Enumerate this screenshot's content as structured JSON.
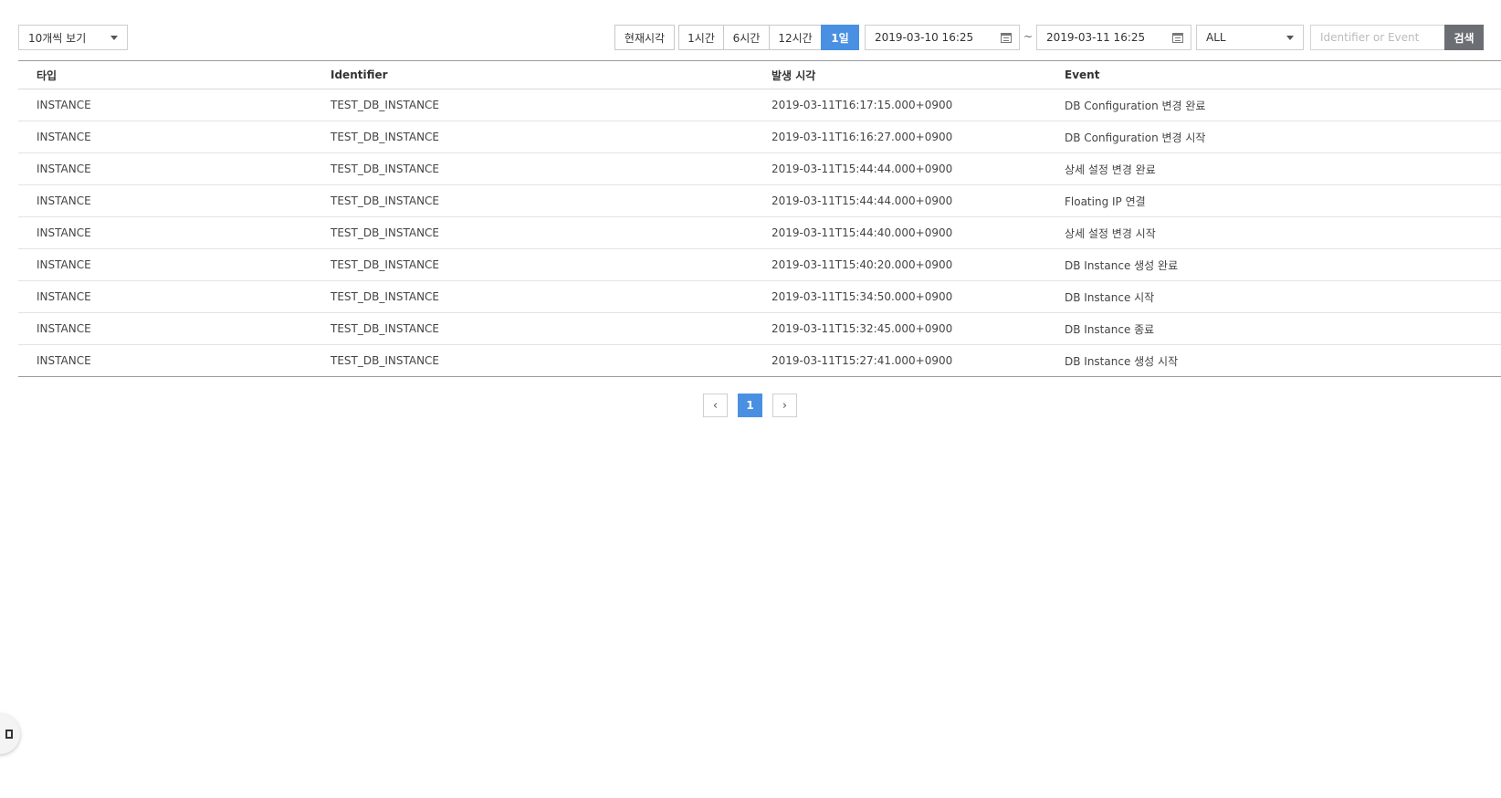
{
  "toolbar": {
    "page_size": "10개씩 보기",
    "time_buttons": [
      "현재시각",
      "1시간",
      "6시간",
      "12시간",
      "1일"
    ],
    "active_time": "1일",
    "date_from": "2019-03-10 16:25",
    "date_separator": "~",
    "date_to": "2019-03-11 16:25",
    "type_filter": "ALL",
    "search_placeholder": "Identifier or Event",
    "search_label": "검색"
  },
  "table": {
    "headers": [
      "타입",
      "Identifier",
      "발생 시각",
      "Event"
    ],
    "rows": [
      [
        "INSTANCE",
        "TEST_DB_INSTANCE",
        "2019-03-11T16:17:15.000+0900",
        "DB Configuration 변경 완료"
      ],
      [
        "INSTANCE",
        "TEST_DB_INSTANCE",
        "2019-03-11T16:16:27.000+0900",
        "DB Configuration 변경 시작"
      ],
      [
        "INSTANCE",
        "TEST_DB_INSTANCE",
        "2019-03-11T15:44:44.000+0900",
        "상세 설정 변경 완료"
      ],
      [
        "INSTANCE",
        "TEST_DB_INSTANCE",
        "2019-03-11T15:44:44.000+0900",
        "Floating IP 연결"
      ],
      [
        "INSTANCE",
        "TEST_DB_INSTANCE",
        "2019-03-11T15:44:40.000+0900",
        "상세 설정 변경 시작"
      ],
      [
        "INSTANCE",
        "TEST_DB_INSTANCE",
        "2019-03-11T15:40:20.000+0900",
        "DB Instance 생성 완료"
      ],
      [
        "INSTANCE",
        "TEST_DB_INSTANCE",
        "2019-03-11T15:34:50.000+0900",
        "DB Instance 시작"
      ],
      [
        "INSTANCE",
        "TEST_DB_INSTANCE",
        "2019-03-11T15:32:45.000+0900",
        "DB Instance 종료"
      ],
      [
        "INSTANCE",
        "TEST_DB_INSTANCE",
        "2019-03-11T15:27:41.000+0900",
        "DB Instance 생성 시작"
      ]
    ]
  },
  "pagination": {
    "prev": "‹",
    "current_page": "1",
    "next": "›"
  },
  "colors": {
    "accent": "#4a90e2",
    "search_button": "#6b6e72"
  },
  "icons": [
    "chevron-down-icon",
    "calendar-icon",
    "chevron-left-icon",
    "chevron-right-icon"
  ]
}
